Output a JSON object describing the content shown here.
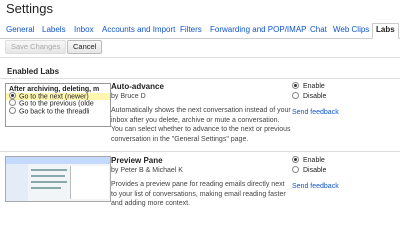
{
  "page_title": "Settings",
  "tabs": [
    {
      "label": "General",
      "active": false
    },
    {
      "label": "Labels",
      "active": false
    },
    {
      "label": "Inbox",
      "active": false
    },
    {
      "label": "Accounts and Import",
      "active": false
    },
    {
      "label": "Filters",
      "active": false
    },
    {
      "label": "Forwarding and POP/IMAP",
      "active": false
    },
    {
      "label": "Chat",
      "active": false
    },
    {
      "label": "Web Clips",
      "active": false
    },
    {
      "label": "Labs",
      "active": true
    }
  ],
  "toolbar": {
    "save_label": "Save Changes",
    "cancel_label": "Cancel"
  },
  "section_title": "Enabled Labs",
  "labs": [
    {
      "title": "Auto-advance",
      "author": "by Bruce D",
      "description": "Automatically shows the next conversation instead of your inbox after you delete, archive or mute a conversation. You can select whether to advance to the next or previous conversation in the \"General Settings\" page.",
      "enable_label": "Enable",
      "disable_label": "Disable",
      "selected": "enable",
      "feedback_label": "Send feedback",
      "preview": {
        "lead": "After archiving, deleting, m",
        "options": [
          "Go to the next (newer)",
          "Go to the previous (olde",
          "Go back to the threadli"
        ],
        "selected_index": 0
      }
    },
    {
      "title": "Preview Pane",
      "author": "by Peter B & Michael K",
      "description": "Provides a preview pane for reading emails directly next to your list of conversations, making email reading faster and adding more context.",
      "enable_label": "Enable",
      "disable_label": "Disable",
      "selected": "enable",
      "feedback_label": "Send feedback"
    }
  ]
}
